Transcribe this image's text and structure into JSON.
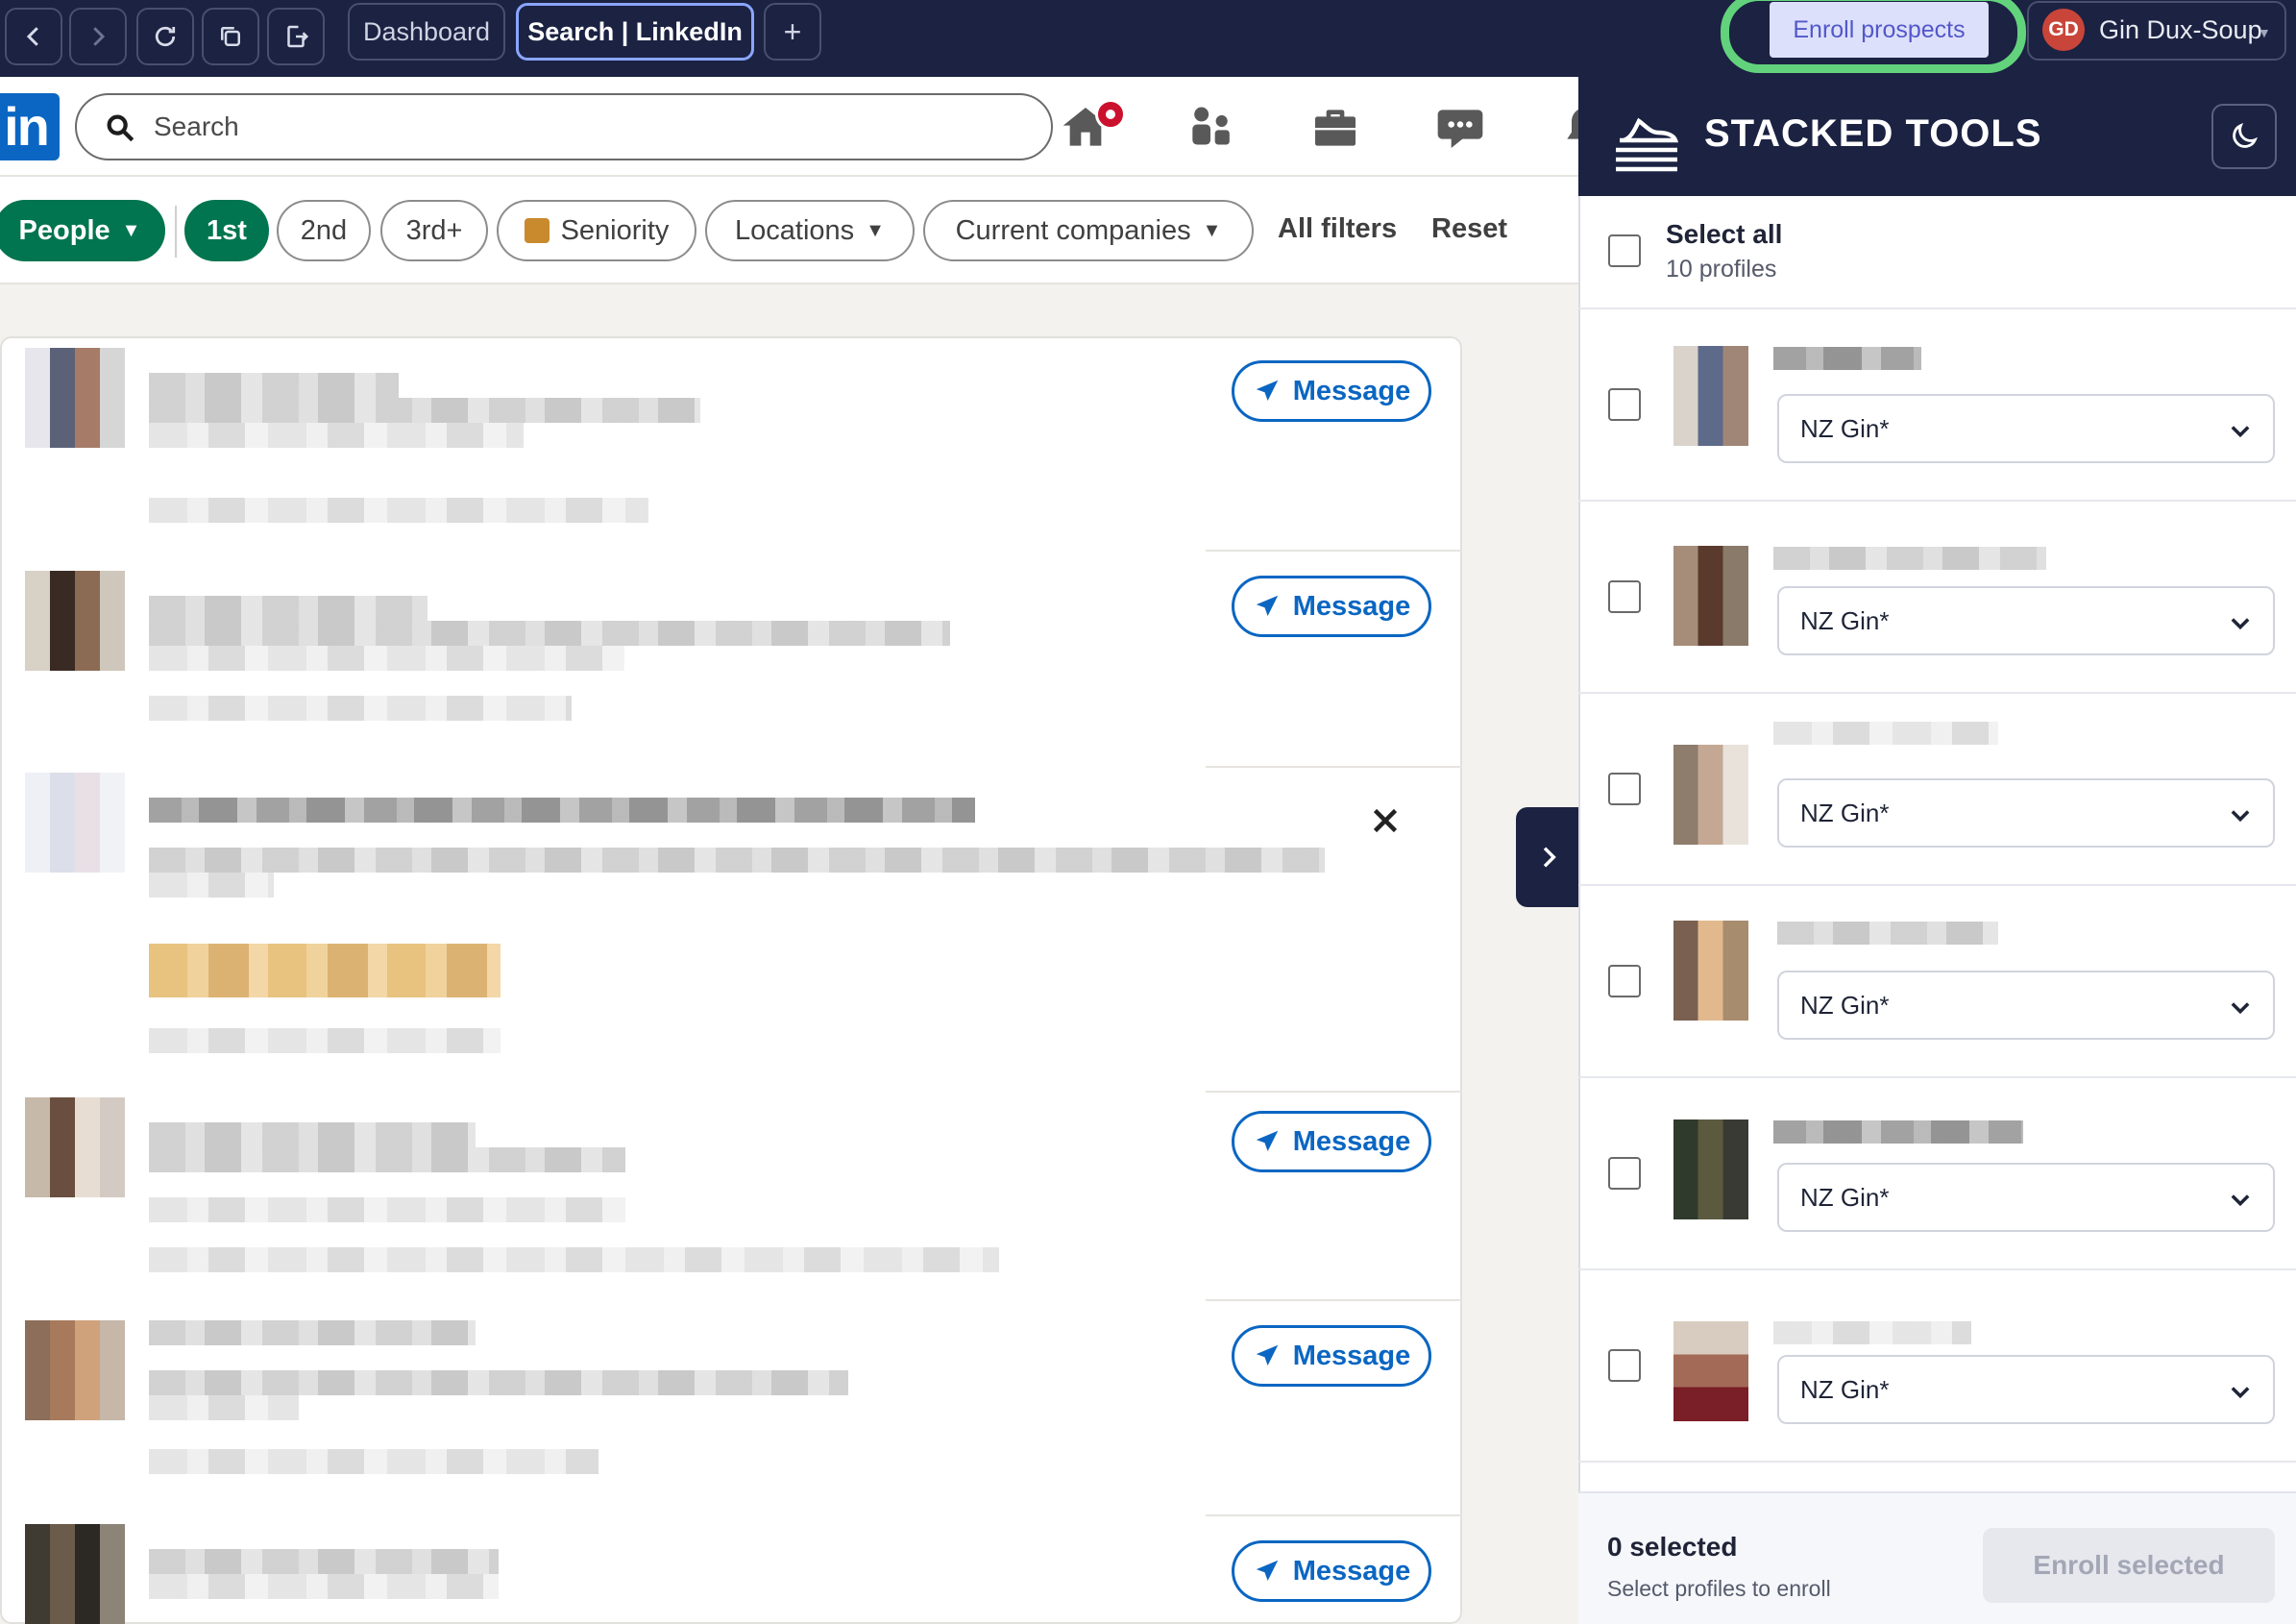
{
  "browser": {
    "tabs": [
      {
        "label": "Dashboard"
      },
      {
        "label": "Search | LinkedIn"
      }
    ],
    "new_tab_label": "+",
    "enroll_button": "Enroll prospects",
    "user": {
      "initials": "GD",
      "name": "Gin Dux-Soup"
    }
  },
  "linkedin": {
    "logo": "in",
    "search_placeholder": "Search",
    "header_icons": [
      "home-icon",
      "network-icon",
      "jobs-icon",
      "messaging-icon",
      "notifications-icon"
    ],
    "filters": {
      "people": "People",
      "degrees": [
        "1st",
        "2nd",
        "3rd+"
      ],
      "seniority": "Seniority",
      "locations": "Locations",
      "companies": "Current companies",
      "all_filters": "All filters",
      "reset": "Reset"
    },
    "results": {
      "message_label": "Message",
      "count_visible": 6
    }
  },
  "panel": {
    "title": "STACKED TOOLS",
    "select_all": "Select all",
    "profile_count": "10 profiles",
    "profiles": [
      {
        "sequence": "NZ Gin*"
      },
      {
        "sequence": "NZ Gin*"
      },
      {
        "sequence": "NZ Gin*"
      },
      {
        "sequence": "NZ Gin*"
      },
      {
        "sequence": "NZ Gin*"
      },
      {
        "sequence": "NZ Gin*"
      }
    ],
    "footer": {
      "selected": "0 selected",
      "help": "Select profiles to enroll",
      "enroll_button": "Enroll selected"
    }
  },
  "colors": {
    "brand_dark": "#1b2242",
    "linkedin_blue": "#0a66c2",
    "linkedin_green": "#01754f",
    "highlight_green": "#62d37c"
  }
}
